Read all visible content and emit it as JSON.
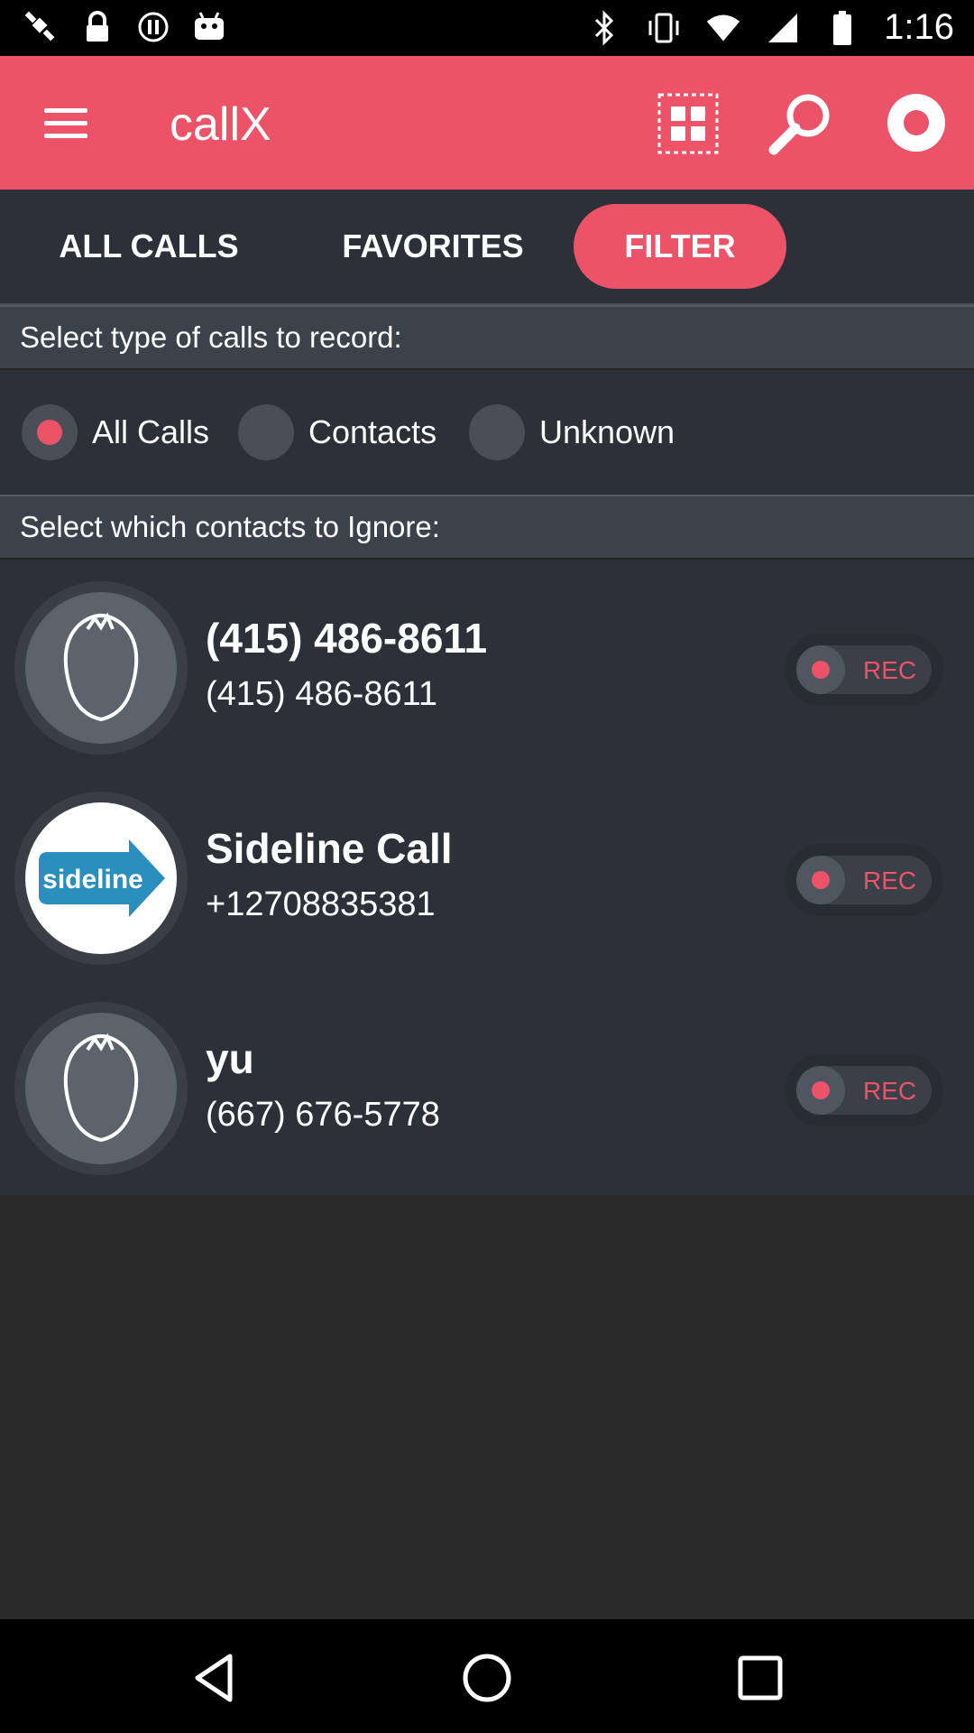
{
  "status_bar": {
    "time": "1:16",
    "left_icons": [
      "satellite-icon",
      "lock-icon",
      "data-saver-icon",
      "android-icon"
    ],
    "right_icons": [
      "bluetooth-icon",
      "vibrate-icon",
      "wifi-icon",
      "signal-icon",
      "battery-icon"
    ]
  },
  "app_bar": {
    "title": "callX",
    "actions": [
      "grid-icon",
      "search-icon",
      "record-icon"
    ],
    "color": "#ec5369"
  },
  "tabs": [
    {
      "label": "ALL CALLS",
      "selected": false
    },
    {
      "label": "FAVORITES",
      "selected": false
    },
    {
      "label": "FILTER",
      "selected": true
    }
  ],
  "record_section": {
    "heading": "Select type of calls to record:",
    "options": [
      {
        "label": "All Calls",
        "selected": true
      },
      {
        "label": "Contacts",
        "selected": false
      },
      {
        "label": "Unknown",
        "selected": false
      }
    ]
  },
  "ignore_section": {
    "heading": "Select which contacts to Ignore:"
  },
  "contacts": [
    {
      "name": "(415) 486-8611",
      "number": "(415) 486-8611",
      "avatar": "default-avatar-icon",
      "toggle_label": "REC"
    },
    {
      "name": "Sideline Call",
      "number": "+12708835381",
      "avatar": "sideline-logo",
      "avatar_text": "sideline",
      "toggle_label": "REC"
    },
    {
      "name": "yu",
      "number": "(667) 676-5778",
      "avatar": "default-avatar-icon",
      "toggle_label": "REC"
    }
  ],
  "nav_bar": [
    "back-icon",
    "home-icon",
    "recents-icon"
  ],
  "colors": {
    "accent": "#ec5369",
    "background": "#2c3038",
    "header": "#3c424c"
  }
}
